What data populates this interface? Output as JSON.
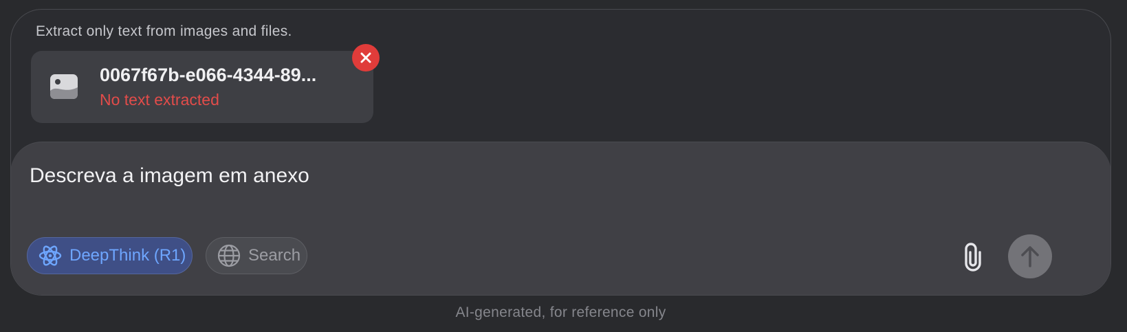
{
  "composer": {
    "hint": "Extract only text from images and files.",
    "attachment": {
      "icon": "image-file-icon",
      "name": "0067f67b-e066-4344-89...",
      "status": "No text extracted",
      "remove_icon": "close-icon"
    },
    "prompt": "Descreva a imagem em anexo",
    "toolbar": {
      "deepthink_label": "DeepThink (R1)",
      "deepthink_icon": "atom-icon",
      "search_label": "Search",
      "search_icon": "globe-icon",
      "attach_icon": "paperclip-icon",
      "send_icon": "arrow-up-icon"
    }
  },
  "footer": {
    "disclaimer": "AI-generated, for reference only"
  },
  "colors": {
    "accent": "#6ea6ff",
    "error": "#e24c4a",
    "background": "#292a2d"
  }
}
